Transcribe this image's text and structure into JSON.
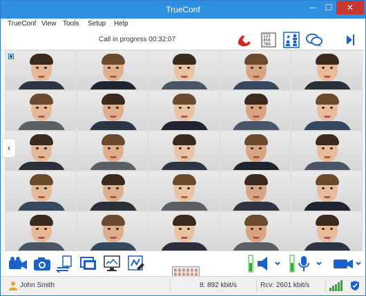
{
  "window": {
    "title": "TrueConf",
    "controls": {
      "minimize": "─",
      "maximize": "☐",
      "close": "✕"
    }
  },
  "menu": [
    "TrueConf",
    "View",
    "Tools",
    "Setup",
    "Help"
  ],
  "call": {
    "status": "Call in progress 00:32:07",
    "icons": [
      "hangup-phone-icon",
      "dialpad-icon",
      "participants-icon",
      "chat-icon",
      "panel-toggle-icon"
    ]
  },
  "video_grid": {
    "rows": 5,
    "columns": 5,
    "participant_count": 25
  },
  "toolbar": {
    "icons": [
      "camera-on-icon",
      "snapshot-icon",
      "transfer-icon",
      "layout-icon",
      "screen-share-icon",
      "slideshow-icon",
      "speaker-icon",
      "microphone-icon",
      "video-camera-icon"
    ]
  },
  "status": {
    "user": "John Smith",
    "send": "8: 892 kbit/s",
    "receive": "Rcv: 2601 kbit/s"
  },
  "colors": {
    "title_bar": "#2f8fe0",
    "accent": "#1a62c9",
    "hangup": "#d0271e",
    "volume": "#2cb02c"
  }
}
